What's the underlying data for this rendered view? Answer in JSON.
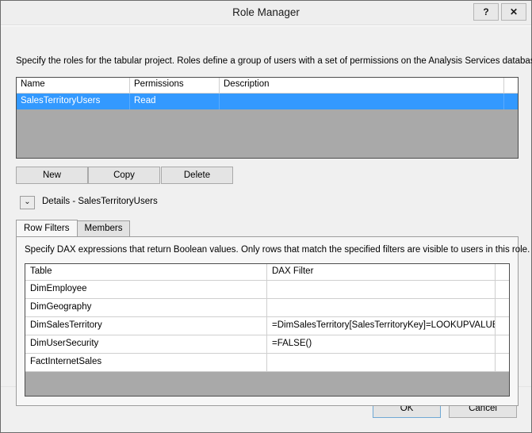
{
  "window": {
    "title": "Role Manager",
    "help_label": "?",
    "close_label": "✕"
  },
  "dialog_description": "Specify the roles for the tabular project. Roles define a group of users with a set of permissions on the Analysis Services database.",
  "roles_grid": {
    "columns": [
      "Name",
      "Permissions",
      "Description",
      ""
    ],
    "rows": [
      {
        "name": "SalesTerritoryUsers",
        "permissions": "Read",
        "description": "",
        "extra": "",
        "selected": true
      }
    ],
    "selection_color": "#3399ff",
    "empty_background": "#a9a9a9"
  },
  "actions": {
    "new_label": "New",
    "copy_label": "Copy",
    "delete_label": "Delete"
  },
  "details": {
    "expander_glyph": "⌄",
    "label": "Details - SalesTerritoryUsers"
  },
  "tabs": [
    {
      "label": "Row Filters",
      "active": true
    },
    {
      "label": "Members",
      "active": false
    }
  ],
  "tab_description": "Specify DAX expressions that return Boolean values. Only rows that match the specified filters are visible to users in this role.",
  "dax_grid": {
    "columns": [
      "Table",
      "DAX Filter",
      ""
    ],
    "rows": [
      {
        "table": "DimEmployee",
        "filter": "",
        "extra": ""
      },
      {
        "table": "DimGeography",
        "filter": "",
        "extra": ""
      },
      {
        "table": "DimSalesTerritory",
        "filter": "=DimSalesTerritory[SalesTerritoryKey]=LOOKUPVALUE(...",
        "extra": ""
      },
      {
        "table": "DimUserSecurity",
        "filter": "=FALSE()",
        "extra": ""
      },
      {
        "table": "FactInternetSales",
        "filter": "",
        "extra": ""
      }
    ],
    "empty_background": "#a9a9a9"
  },
  "footer": {
    "ok_label": "OK",
    "cancel_label": "Cancel",
    "default_button_accent": "#6fa8d4"
  }
}
